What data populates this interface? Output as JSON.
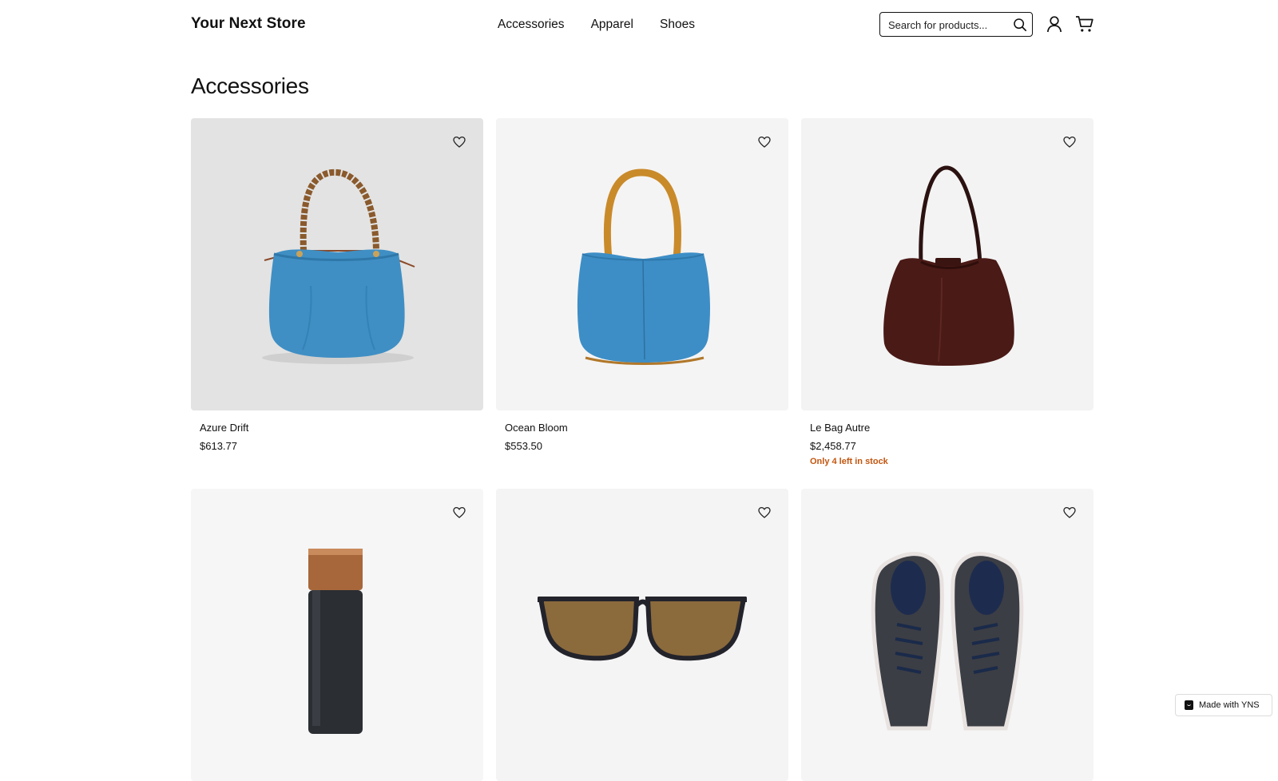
{
  "header": {
    "logo": "Your Next Store",
    "nav": [
      "Accessories",
      "Apparel",
      "Shoes"
    ],
    "search_placeholder": "Search for products...",
    "icons": [
      "search-icon",
      "user-icon",
      "cart-icon"
    ]
  },
  "main": {
    "title": "Accessories",
    "products": [
      {
        "name": "Azure Drift",
        "price": "$613.77",
        "stock_note": "",
        "image": "blue tote bag with bamboo handles",
        "bg": "#e3e3e3"
      },
      {
        "name": "Ocean Bloom",
        "price": "$553.50",
        "stock_note": "",
        "image": "blue leather bucket bag with tan handle",
        "bg": "#f5f4f4"
      },
      {
        "name": "Le Bag Autre",
        "price": "$2,458.77",
        "stock_note": "Only 4 left in stock",
        "image": "dark brown leather shoulder bag",
        "bg": "#f3f3f3"
      },
      {
        "name": "",
        "price": "",
        "stock_note": "",
        "image": "black water bottle with copper cap",
        "bg": "#f6f6f6"
      },
      {
        "name": "",
        "price": "",
        "stock_note": "",
        "image": "brown tinted sunglasses",
        "bg": "#f4f4f4"
      },
      {
        "name": "",
        "price": "",
        "stock_note": "",
        "image": "dark grey knit sneakers",
        "bg": "#f5f5f5"
      }
    ]
  },
  "footer_badge": "Made with YNS",
  "colors": {
    "stock_warning": "#c2550f",
    "text": "#111111"
  }
}
